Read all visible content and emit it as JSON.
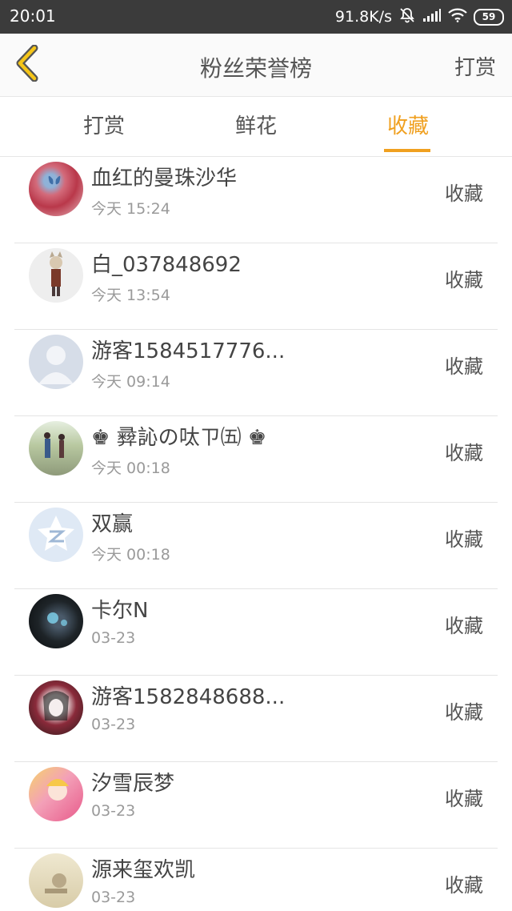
{
  "status_bar": {
    "time": "20:01",
    "speed": "91.8K/s",
    "battery": "59",
    "icons": [
      "mute-bell-icon",
      "signal-icon",
      "wifi-icon",
      "battery-icon"
    ]
  },
  "header": {
    "title": "粉丝荣誉榜",
    "right_action": "打赏",
    "back_icon": "chevron-left-icon",
    "accent": "#f0a020"
  },
  "tabs": [
    {
      "label": "打赏",
      "active": false
    },
    {
      "label": "鲜花",
      "active": false
    },
    {
      "label": "收藏",
      "active": true
    }
  ],
  "fans": [
    {
      "name": "血红的曼珠沙华",
      "time": "今天 15:24",
      "action": "收藏",
      "avatar": "butterfly-avatar"
    },
    {
      "name": "白_037848692",
      "time": "今天 13:54",
      "action": "收藏",
      "avatar": "anime-girl-avatar"
    },
    {
      "name": "游客1584517776...",
      "time": "今天 09:14",
      "action": "收藏",
      "avatar": "default-user-avatar"
    },
    {
      "name": "♚ 彛訫の呔ㄗ㈤ ♚",
      "time": "今天 00:18",
      "action": "收藏",
      "avatar": "couple-avatar"
    },
    {
      "name": "双赢",
      "time": "今天 00:18",
      "action": "收藏",
      "avatar": "qzone-star-avatar"
    },
    {
      "name": "卡尔N",
      "time": "03-23",
      "action": "收藏",
      "avatar": "dark-car-avatar"
    },
    {
      "name": "游客1582848688...",
      "time": "03-23",
      "action": "收藏",
      "avatar": "anime-sketch-avatar"
    },
    {
      "name": "汐雪辰梦",
      "time": "03-23",
      "action": "收藏",
      "avatar": "pink-girl-avatar"
    },
    {
      "name": "源来玺欢凯",
      "time": "03-23",
      "action": "收藏",
      "avatar": "sepia-avatar"
    }
  ]
}
